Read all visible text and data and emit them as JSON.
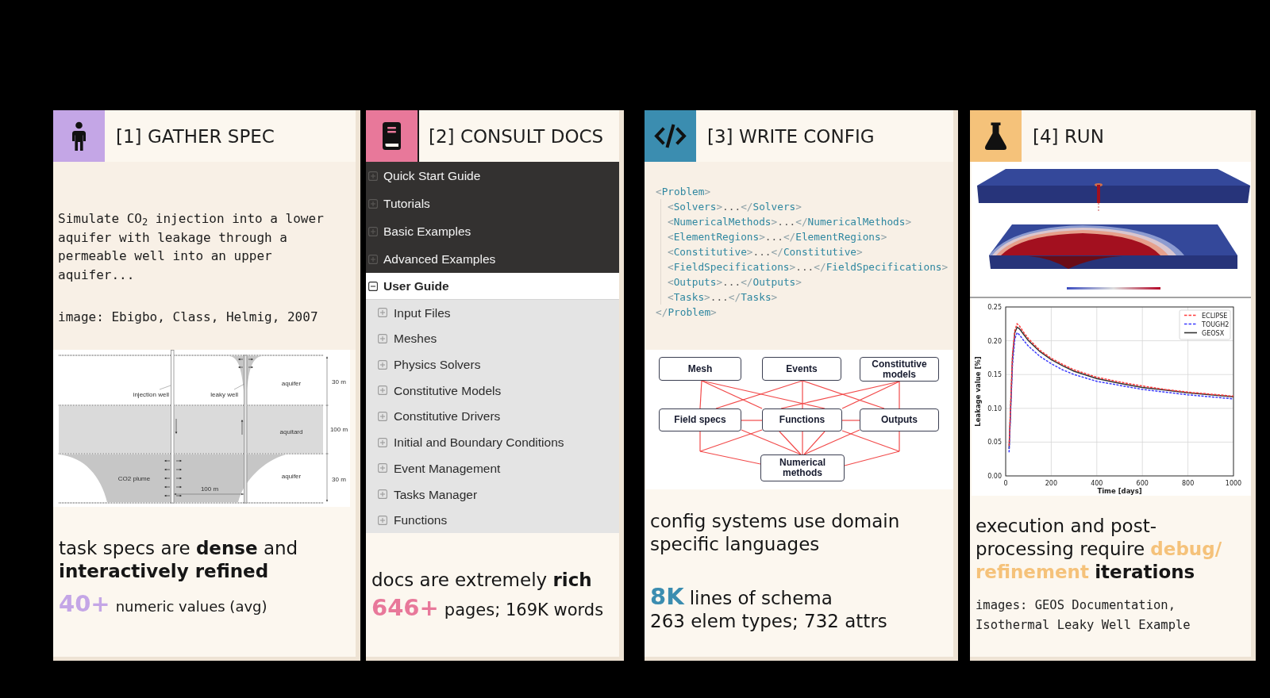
{
  "cards": [
    {
      "kind": "spec",
      "title": "[1] GATHER SPEC",
      "color": "#c4a6e6",
      "description": "Simulate CO$_{2}$ injection into a lower aquifer with leakage through a permeable well into an upper aquifer...",
      "credit": "image: Ebigbo, Class, Helmig, 2007",
      "diagram": {
        "injection_well_label": "injection well",
        "leaky_well_label": "leaky well",
        "layer_labels": [
          "aquifer",
          "aquitard",
          "aquifer"
        ],
        "plume_label": "CO2 plume",
        "spacing_label": "100 m",
        "thickness_labels": [
          "30 m",
          "100 m",
          "30 m"
        ]
      },
      "summary": "task specs are **dense** and **interactively refined**",
      "stat": {
        "value": "40+",
        "label": "numeric values (avg)"
      }
    },
    {
      "kind": "docs",
      "title": "[2] CONSULT DOCS",
      "color": "#e8789a",
      "nav": [
        {
          "label": "Quick Start Guide",
          "expanded": false,
          "selected": false
        },
        {
          "label": "Tutorials",
          "expanded": false,
          "selected": false
        },
        {
          "label": "Basic Examples",
          "expanded": false,
          "selected": false
        },
        {
          "label": "Advanced Examples",
          "expanded": false,
          "selected": false
        },
        {
          "label": "User Guide",
          "expanded": true,
          "selected": true,
          "children": [
            {
              "label": "Input Files",
              "expanded": false,
              "selected": false
            },
            {
              "label": "Meshes",
              "expanded": false,
              "selected": false
            },
            {
              "label": "Physics Solvers",
              "expanded": false,
              "selected": false
            },
            {
              "label": "Constitutive Models",
              "expanded": false,
              "selected": false
            },
            {
              "label": "Constitutive Drivers",
              "expanded": false,
              "selected": false
            },
            {
              "label": "Initial and Boundary Conditions",
              "expanded": false,
              "selected": false
            },
            {
              "label": "Event Management",
              "expanded": false,
              "selected": false
            },
            {
              "label": "Tasks Manager",
              "expanded": false,
              "selected": false
            },
            {
              "label": "Functions",
              "expanded": false,
              "selected": false
            }
          ]
        }
      ],
      "summary": "docs are extremely **rich**",
      "stat": {
        "value": "646+",
        "label": "pages; 169K words"
      }
    },
    {
      "kind": "config",
      "title": "[3] WRITE CONFIG",
      "color": "#3b8db0",
      "code": {
        "open": "<Problem>",
        "children": [
          "<Solvers>...</Solvers>",
          "<NumericalMethods>...</NumericalMethods>",
          "<ElementRegions>...</ElementRegions>",
          "<Constitutive>...</Constitutive>",
          "<FieldSpecifications>...</FieldSpecifications>",
          "<Outputs>...</Outputs>",
          "<Tasks>...</Tasks>"
        ],
        "close": "</Problem>"
      },
      "graph": {
        "nodes": [
          "Mesh",
          "Events",
          "Constitutive models",
          "Field specs",
          "Functions",
          "Outputs",
          "Numerical methods"
        ]
      },
      "summary": "config systems use domain specific languages",
      "stat": {
        "value": "8K",
        "label": "lines of schema"
      },
      "detail": "263 elem types; 732 attrs"
    },
    {
      "kind": "run",
      "title": "[4] RUN",
      "color": "#f5c27a",
      "chart_data": {
        "type": "line",
        "xlabel": "Time [days]",
        "ylabel": "Leakage value [%]",
        "x": [
          15,
          20,
          30,
          40,
          50,
          60,
          80,
          100,
          150,
          200,
          250,
          300,
          400,
          500,
          600,
          700,
          800,
          900,
          1000
        ],
        "series": [
          {
            "name": "ECLIPSE",
            "color": "#ff3b3b",
            "line_style": "dashed",
            "values": [
              0.045,
              0.09,
              0.18,
              0.215,
              0.225,
              0.222,
              0.212,
              0.203,
              0.186,
              0.174,
              0.165,
              0.157,
              0.146,
              0.139,
              0.133,
              0.128,
              0.124,
              0.121,
              0.118
            ]
          },
          {
            "name": "TOUGH2",
            "color": "#3b3bff",
            "line_style": "dashed",
            "values": [
              0.035,
              0.08,
              0.165,
              0.203,
              0.212,
              0.209,
              0.2,
              0.192,
              0.177,
              0.166,
              0.157,
              0.15,
              0.14,
              0.134,
              0.128,
              0.124,
              0.12,
              0.117,
              0.114
            ]
          },
          {
            "name": "GEOSX",
            "color": "#333333",
            "line_style": "solid",
            "values": [
              0.04,
              0.085,
              0.175,
              0.212,
              0.22,
              0.218,
              0.209,
              0.2,
              0.184,
              0.172,
              0.163,
              0.155,
              0.144,
              0.137,
              0.131,
              0.127,
              0.123,
              0.12,
              0.117
            ]
          }
        ],
        "xlim": [
          0,
          1000
        ],
        "ylim": [
          0,
          0.25
        ],
        "xticks": [
          0,
          200,
          400,
          600,
          800,
          1000
        ],
        "yticks": [
          {
            "value": 0,
            "label": "0.00"
          },
          {
            "value": 0.05,
            "label": "0.05"
          },
          {
            "value": 0.1,
            "label": "0.10"
          },
          {
            "value": 0.15,
            "label": "0.15"
          },
          {
            "value": 0.2,
            "label": "0.20"
          },
          {
            "value": 0.25,
            "label": "0.25"
          }
        ],
        "grid": true,
        "legend": "upper right"
      },
      "summary": "execution and post-processing require",
      "highlight": "debug/refinement",
      "summary_end": "iterations",
      "credit": "images: GEOS Documentation, Isothermal Leaky Well Example"
    }
  ]
}
